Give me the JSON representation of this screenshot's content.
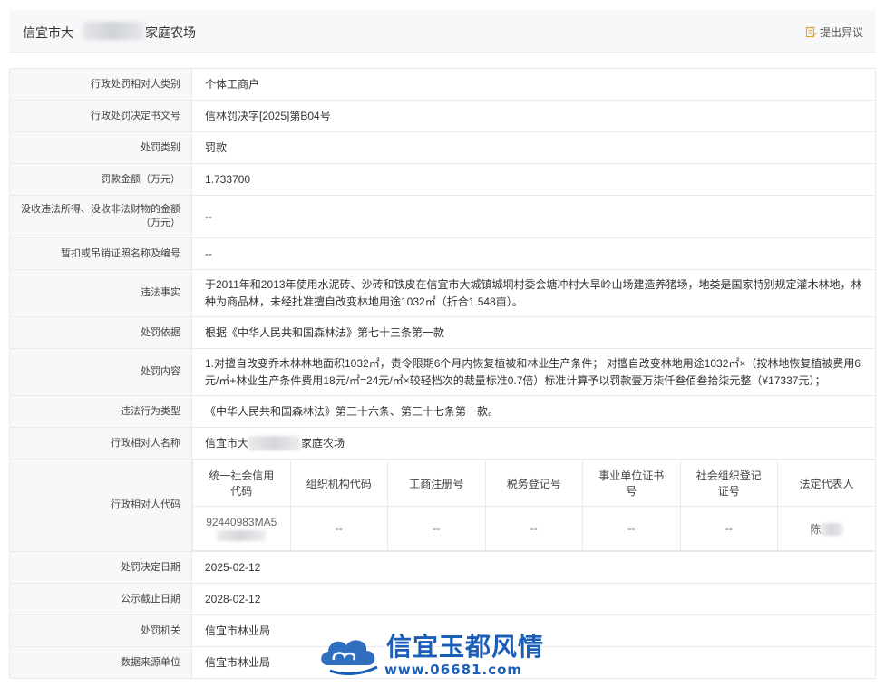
{
  "header": {
    "title_prefix": "信宜市大",
    "title_suffix": "家庭农场",
    "objection_label": "提出异议"
  },
  "rows": {
    "counterparty_type": {
      "label": "行政处罚相对人类别",
      "value": "个体工商户"
    },
    "decision_no": {
      "label": "行政处罚决定书文号",
      "value": "信林罚决字[2025]第B04号"
    },
    "penalty_type": {
      "label": "处罚类别",
      "value": "罚款"
    },
    "fine_amount": {
      "label": "罚款金额（万元）",
      "value": "1.733700"
    },
    "confiscation": {
      "label": "没收违法所得、没收非法财物的金额（万元）",
      "value": "--"
    },
    "license": {
      "label": "暂扣或吊销证照名称及编号",
      "value": "--"
    },
    "facts": {
      "label": "违法事实",
      "value": "于2011年和2013年使用水泥砖、沙砖和铁皮在信宜市大城镇城垌村委会塘冲村大旱岭山场建造养猪场，地类是国家特别规定灌木林地，林种为商品林，未经批准擅自改变林地用途1032㎡（折合1.548亩）。"
    },
    "basis": {
      "label": "处罚依据",
      "value": "根据《中华人民共和国森林法》第七十三条第一款"
    },
    "content": {
      "label": "处罚内容",
      "value": "1.对擅自改变乔木林林地面积1032㎡，责令限期6个月内恢复植被和林业生产条件； 对擅自改变林地用途1032㎡×（按林地恢复植被费用6元/㎡+林业生产条件费用18元/㎡=24元/㎡×较轻档次的裁量标准0.7倍）标准计算予以罚款壹万柒仟叁佰叁拾柒元整（¥17337元）；"
    },
    "violation_type": {
      "label": "违法行为类型",
      "value": "《中华人民共和国森林法》第三十六条、第三十七条第一款。"
    },
    "counterparty_name": {
      "label": "行政相对人名称",
      "value_prefix": "信宜市大",
      "value_suffix": "家庭农场"
    },
    "counterparty_code": {
      "label": "行政相对人代码"
    },
    "decision_date": {
      "label": "处罚决定日期",
      "value": "2025-02-12"
    },
    "publish_end": {
      "label": "公示截止日期",
      "value": "2028-02-12"
    },
    "authority": {
      "label": "处罚机关",
      "value": "信宜市林业局"
    },
    "source": {
      "label": "数据来源单位",
      "value": "信宜市林业局"
    }
  },
  "code_table": {
    "headers": [
      "统一社会信用代码",
      "组织机构代码",
      "工商注册号",
      "税务登记号",
      "事业单位证书号",
      "社会组织登记证号",
      "法定代表人"
    ],
    "values": [
      "92440983MA5",
      "--",
      "--",
      "--",
      "--",
      "--",
      "陈"
    ]
  },
  "watermark": {
    "title": "信宜玉都风情",
    "url": "www.06681.com",
    "colors": {
      "brand": "#1a5eb8"
    }
  },
  "colors": {
    "label_bg": "#f7f8fa",
    "border": "#e8eaee",
    "icon": "#f0a020"
  }
}
